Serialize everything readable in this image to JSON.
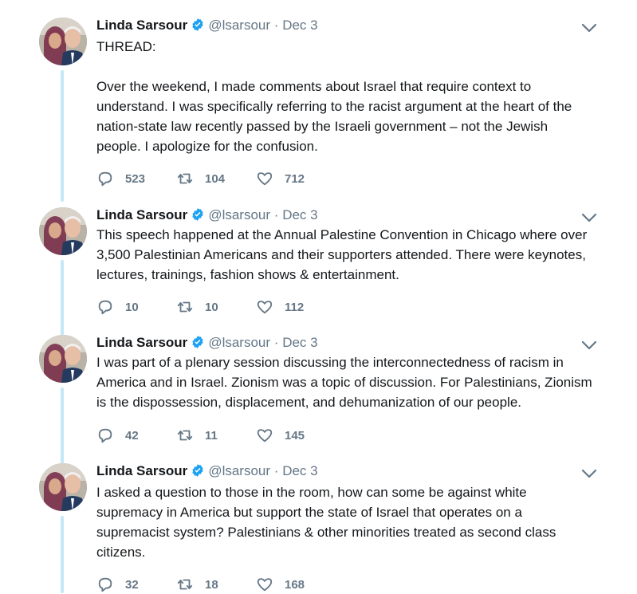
{
  "tweets": [
    {
      "name": "Linda Sarsour",
      "handle": "@lsarsour",
      "dot": "·",
      "date": "Dec 3",
      "text": [
        "THREAD:",
        "",
        "Over the weekend, I made comments about Israel that require context to",
        "understand. I was specifically referring to the racist argument at the heart of the",
        "nation-state law recently passed by the Israeli government – not the Jewish",
        "people. I apologize for the confusion."
      ],
      "replies": "523",
      "retweets": "104",
      "likes": "712"
    },
    {
      "name": "Linda Sarsour",
      "handle": "@lsarsour",
      "dot": "·",
      "date": "Dec 3",
      "text": [
        "This speech happened at the Annual Palestine Convention in Chicago where over",
        "3,500 Palestinian Americans and their supporters attended. There were keynotes,",
        "lectures, trainings, fashion shows & entertainment."
      ],
      "replies": "10",
      "retweets": "10",
      "likes": "112"
    },
    {
      "name": "Linda Sarsour",
      "handle": "@lsarsour",
      "dot": "·",
      "date": "Dec 3",
      "text": [
        "I was part of a plenary session discussing the interconnectedness of racism in",
        "America and in Israel. Zionism was a topic of discussion. For Palestinians, Zionism",
        "is the dispossession, displacement, and dehumanization of our people."
      ],
      "replies": "42",
      "retweets": "11",
      "likes": "145"
    },
    {
      "name": "Linda Sarsour",
      "handle": "@lsarsour",
      "dot": "·",
      "date": "Dec 3",
      "text": [
        "I asked a question to those in the room, how can some be against white",
        "supremacy in America but support the state of Israel that operates on a",
        "supremacist system? Palestinians & other minorities treated as second class",
        "citizens."
      ],
      "replies": "32",
      "retweets": "18",
      "likes": "168"
    }
  ],
  "colors": {
    "verified": "#1da1f2",
    "muted": "#657786",
    "thread_line": "#c4e8f8"
  }
}
